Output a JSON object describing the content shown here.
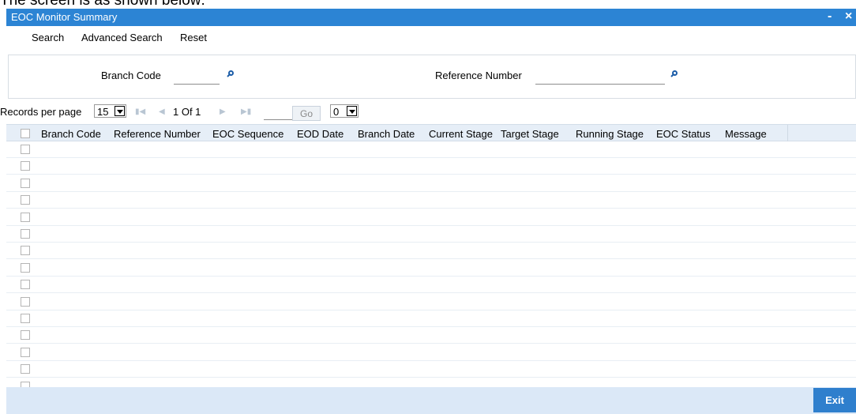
{
  "caption": "The screen is as shown below:",
  "window": {
    "title": "EOC Monitor Summary",
    "minimize_symbol": "-",
    "close_symbol": "×"
  },
  "menu": {
    "search": "Search",
    "advanced_search": "Advanced Search",
    "reset": "Reset"
  },
  "criteria": {
    "branch_code_label": "Branch Code",
    "branch_code_value": "",
    "reference_number_label": "Reference Number",
    "reference_number_value": ""
  },
  "pager": {
    "records_label": "Records per page",
    "records_value": "15",
    "page_info": "1 Of 1",
    "page_input_value": "",
    "go_label": "Go",
    "selected_value": "0",
    "first_icon": "first-page-icon",
    "prev_icon": "previous-page-icon",
    "next_icon": "next-page-icon",
    "last_icon": "last-page-icon"
  },
  "table": {
    "columns": [
      "Branch Code",
      "Reference Number",
      "EOC Sequence",
      "EOD Date",
      "Branch Date",
      "Current Stage",
      "Target Stage",
      "Running Stage",
      "EOC Status",
      "Message"
    ],
    "row_count": 15
  },
  "footer": {
    "exit_label": "Exit"
  },
  "colors": {
    "titlebar": "#2c84d4",
    "header_bg": "#e6eef7",
    "footer_bg": "#dbe8f7",
    "exit_button": "#2f7fcd"
  }
}
